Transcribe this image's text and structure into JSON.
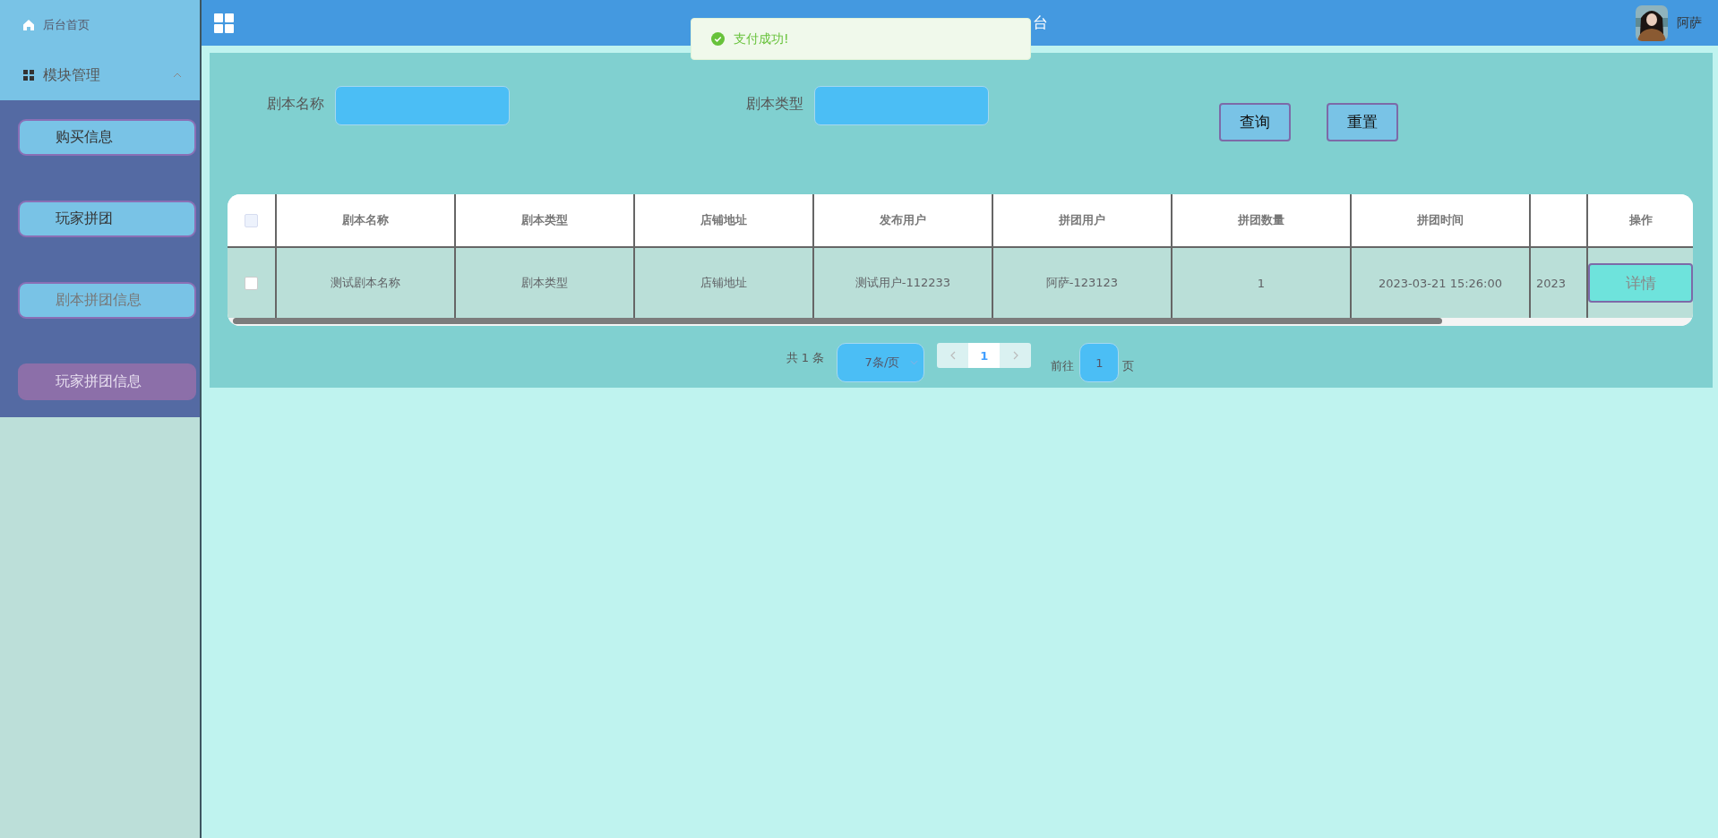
{
  "sidebar": {
    "home": "后台首页",
    "group": {
      "label": "模块管理",
      "expanded": true
    },
    "items": [
      {
        "label": "购买信息",
        "selected": false,
        "hovered": false
      },
      {
        "label": "玩家拼团",
        "selected": false,
        "hovered": false
      },
      {
        "label": "剧本拼团信息",
        "selected": true,
        "hovered": false
      },
      {
        "label": "玩家拼团信息",
        "selected": false,
        "hovered": true
      }
    ]
  },
  "header": {
    "title_visible_part": "台",
    "user": "阿萨"
  },
  "toast": {
    "kind": "success",
    "message": "支付成功!"
  },
  "search": {
    "fields": [
      {
        "label": "剧本名称"
      },
      {
        "label": "剧本类型"
      }
    ],
    "buttons": [
      "查询",
      "重置"
    ]
  },
  "table": {
    "select_all": {
      "checked": false
    },
    "columns": [
      "剧本名称",
      "剧本类型",
      "店铺地址",
      "发布用户",
      "拼团用户",
      "拼团数量",
      "拼团时间"
    ],
    "action_column": "操作",
    "rows": [
      {
        "checked": false,
        "cells": [
          "测试剧本名称",
          "剧本类型",
          "店铺地址",
          "测试用户-112233",
          "阿萨-123123",
          "1",
          "2023-03-21 15:26:00"
        ],
        "column_8": "2023",
        "action": "详情"
      }
    ]
  },
  "pagination": {
    "total": "共 1 条",
    "page_size": "7条/页",
    "current_page": "1",
    "goto_label": "前往",
    "goto_value": "1",
    "page_unit": "页"
  }
}
